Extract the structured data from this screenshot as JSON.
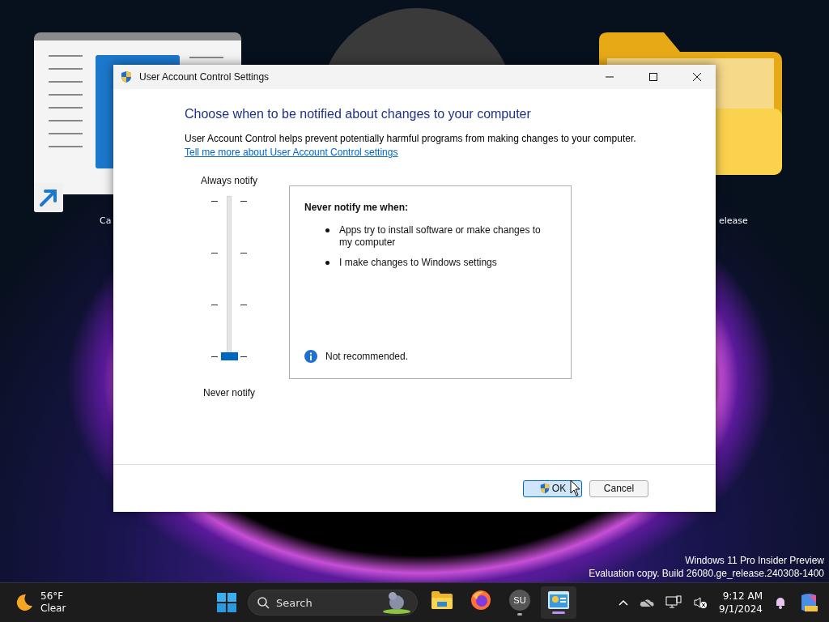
{
  "desktop": {
    "icons": [
      {
        "kind": "shortcut",
        "label": "Ca"
      },
      {
        "kind": "folder",
        "label": "elease"
      }
    ],
    "watermark": [
      "Windows 11 Pro Insider Preview",
      "Evaluation copy. Build 26080.ge_release.240308-1400"
    ]
  },
  "window": {
    "title": "User Account Control Settings",
    "heading": "Choose when to be notified about changes to your computer",
    "description": "User Account Control helps prevent potentially harmful programs from making changes to your computer.",
    "link": "Tell me more about User Account Control settings",
    "slider": {
      "top_label": "Always notify",
      "bottom_label": "Never notify",
      "level": 0
    },
    "info": {
      "title": "Never notify me when:",
      "bullets": [
        "Apps try to install software or make changes to my computer",
        "I make changes to Windows settings"
      ],
      "note": "Not recommended."
    },
    "buttons": [
      {
        "label": "OK",
        "default": true,
        "shield": true
      },
      {
        "label": "Cancel",
        "default": false,
        "shield": false
      }
    ]
  },
  "taskbar": {
    "weather": {
      "temperature": "56°F",
      "condition": "Clear"
    },
    "search": {
      "placeholder": "Search"
    },
    "apps": [
      {
        "kind": "folder",
        "running": false,
        "active": false
      },
      {
        "kind": "browser",
        "running": false,
        "active": false
      },
      {
        "kind": "su",
        "label": "SU",
        "running": true,
        "active": false
      },
      {
        "kind": "uac",
        "active": true
      }
    ],
    "clock": {
      "time": "9:12 AM",
      "date": "9/1/2024"
    }
  }
}
